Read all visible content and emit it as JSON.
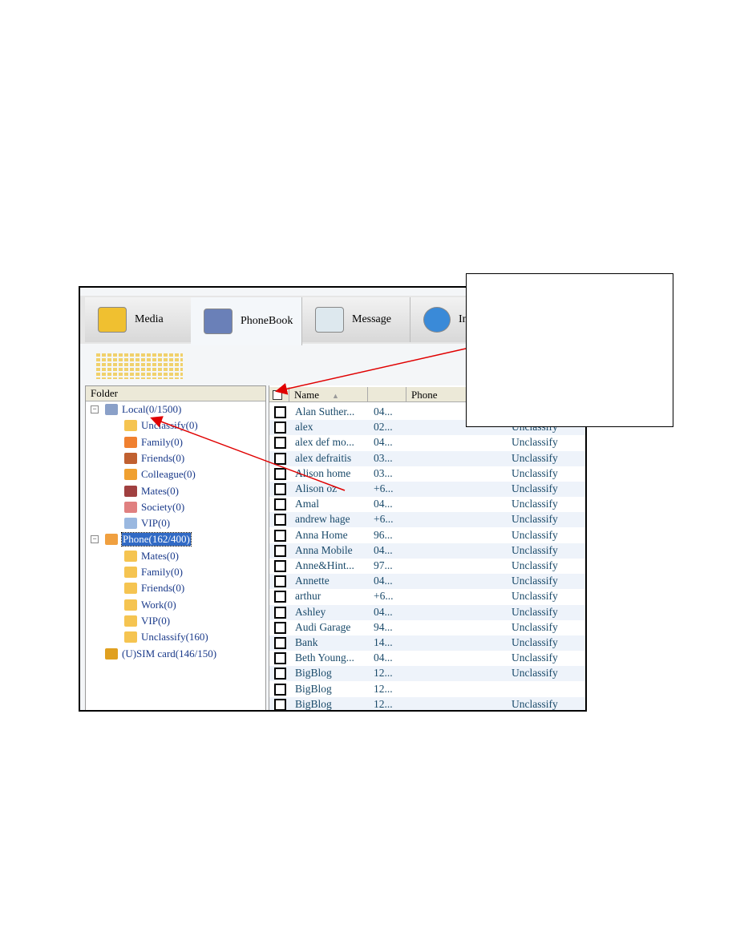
{
  "tabs": [
    {
      "label": "Media",
      "icon": "media-icon",
      "color": "#f0c030"
    },
    {
      "label": "PhoneBook",
      "icon": "phonebook-icon",
      "color": "#6a80b8"
    },
    {
      "label": "Message",
      "icon": "message-icon",
      "color": "#dde8ee"
    },
    {
      "label": "In",
      "icon": "internet-globe-icon",
      "color": "#3a8ad8"
    }
  ],
  "folder": {
    "header": "Folder",
    "nodes": [
      {
        "label": "Local(0/1500)",
        "icon": "computer-icon",
        "level": 0,
        "expand": "⊟",
        "color": "#8aa0c8"
      },
      {
        "label": "Unclassify(0)",
        "icon": "folder-icon",
        "level": 1,
        "color": "#f5c451"
      },
      {
        "label": "Family(0)",
        "icon": "house-icon",
        "level": 1,
        "color": "#f08030"
      },
      {
        "label": "Friends(0)",
        "icon": "friends-icon",
        "level": 1,
        "color": "#c06030"
      },
      {
        "label": "Colleague(0)",
        "icon": "colleague-icon",
        "level": 1,
        "color": "#f0a030"
      },
      {
        "label": "Mates(0)",
        "icon": "mates-icon",
        "level": 1,
        "color": "#a04040"
      },
      {
        "label": "Society(0)",
        "icon": "society-icon",
        "level": 1,
        "color": "#e08080"
      },
      {
        "label": "VIP(0)",
        "icon": "vip-card-icon",
        "level": 1,
        "color": "#9ab8e0"
      },
      {
        "label": "Phone(162/400)",
        "icon": "phone-icon",
        "level": 0,
        "expand": "⊟",
        "selected": true,
        "color": "#f0a040"
      },
      {
        "label": "Mates(0)",
        "icon": "folder-icon",
        "level": 1,
        "color": "#f5c451"
      },
      {
        "label": "Family(0)",
        "icon": "folder-icon",
        "level": 1,
        "color": "#f5c451"
      },
      {
        "label": "Friends(0)",
        "icon": "folder-icon",
        "level": 1,
        "color": "#f5c451"
      },
      {
        "label": "Work(0)",
        "icon": "folder-icon",
        "level": 1,
        "color": "#f5c451"
      },
      {
        "label": "VIP(0)",
        "icon": "folder-icon",
        "level": 1,
        "color": "#f5c451"
      },
      {
        "label": "Unclassify(160)",
        "icon": "folder-icon",
        "level": 1,
        "color": "#f5c451"
      },
      {
        "label": "(U)SIM card(146/150)",
        "icon": "sim-card-icon",
        "level": 0,
        "color": "#e0a020"
      }
    ]
  },
  "table": {
    "columns": [
      "",
      "Name",
      "",
      "Phone",
      ""
    ],
    "rows": [
      [
        "Alan Suther...",
        "04...",
        ""
      ],
      [
        "alex",
        "02...",
        "Unclassify"
      ],
      [
        "alex def  mo...",
        "04...",
        "Unclassify"
      ],
      [
        "alex defraitis",
        "03...",
        "Unclassify"
      ],
      [
        "Alison home",
        "03...",
        "Unclassify"
      ],
      [
        "Alison oz",
        "+6...",
        "Unclassify"
      ],
      [
        "Amal",
        "04...",
        "Unclassify"
      ],
      [
        "andrew hage",
        "+6...",
        "Unclassify"
      ],
      [
        "Anna Home",
        "96...",
        "Unclassify"
      ],
      [
        "Anna Mobile",
        "04...",
        "Unclassify"
      ],
      [
        "Anne&Hint...",
        "97...",
        "Unclassify"
      ],
      [
        "Annette",
        "04...",
        "Unclassify"
      ],
      [
        "arthur",
        "+6...",
        "Unclassify"
      ],
      [
        "Ashley",
        "04...",
        "Unclassify"
      ],
      [
        "Audi Garage",
        "94...",
        "Unclassify"
      ],
      [
        "Bank",
        "14...",
        "Unclassify"
      ],
      [
        "Beth Young...",
        "04...",
        "Unclassify"
      ],
      [
        "BigBlog",
        "12...",
        "Unclassify"
      ],
      [
        "BigBlog",
        "12...",
        ""
      ],
      [
        "BigBlog",
        "12...",
        "Unclassify"
      ]
    ]
  },
  "annotation_color": "#e00000"
}
